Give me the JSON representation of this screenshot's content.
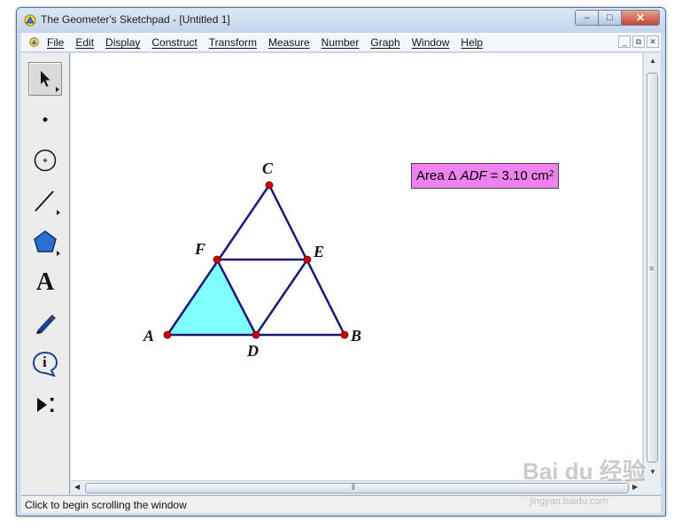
{
  "window": {
    "title": "The Geometer's Sketchpad - [Untitled 1]",
    "controls": [
      "minimize-icon",
      "maximize-icon",
      "close-icon"
    ],
    "caption_glyphs": {
      "minimize": "–",
      "maximize": "□",
      "close": "✕"
    }
  },
  "menu": {
    "items": [
      "File",
      "Edit",
      "Display",
      "Construct",
      "Transform",
      "Measure",
      "Number",
      "Graph",
      "Window",
      "Help"
    ],
    "mdi_glyphs": {
      "minimize": "_",
      "restore": "⧉",
      "close": "✕"
    }
  },
  "toolbox": {
    "tools": [
      {
        "name": "selection-arrow-tool",
        "icon": "arrow-cursor-icon",
        "active": true
      },
      {
        "name": "point-tool",
        "icon": "dot-icon"
      },
      {
        "name": "compass-tool",
        "icon": "circle-icon"
      },
      {
        "name": "straightedge-tool",
        "icon": "line-segment-icon"
      },
      {
        "name": "polygon-tool",
        "icon": "pentagon-icon"
      },
      {
        "name": "text-tool",
        "icon": "letter-a-icon",
        "glyph": "A"
      },
      {
        "name": "marker-tool",
        "icon": "pen-icon"
      },
      {
        "name": "information-tool",
        "icon": "info-bubble-icon",
        "glyph": "i"
      },
      {
        "name": "custom-tool",
        "icon": "play-more-icon"
      }
    ]
  },
  "sketch": {
    "points": {
      "A": "A",
      "B": "B",
      "C": "C",
      "D": "D",
      "E": "E",
      "F": "F"
    },
    "colors": {
      "segment": "#1a1a78",
      "point": "#cc0000",
      "fill": "#80ffff",
      "measure_bg": "#ee82ee"
    },
    "measurement": {
      "prefix": "Area",
      "triangle_symbol": "Δ",
      "triangle_name": "ADF",
      "equals": "=",
      "value": "3.10",
      "unit": "cm",
      "exponent": "2"
    }
  },
  "status": {
    "text": "Click to begin scrolling the window"
  },
  "watermark": {
    "text": "Bai du 经验",
    "sub": "jingyan.baidu.com"
  }
}
